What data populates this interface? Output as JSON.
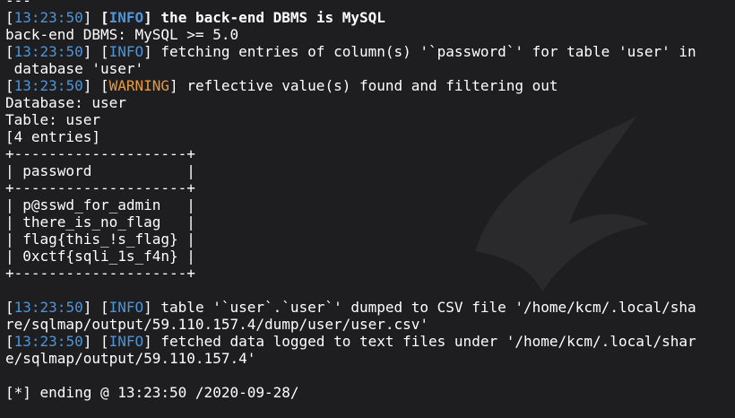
{
  "terminal": {
    "top_line": "---",
    "l1": {
      "timestamp": "13:23:50",
      "level": "INFO",
      "message": "the back-end DBMS is MySQL"
    },
    "l2": "back-end DBMS: MySQL >= 5.0",
    "l3": {
      "timestamp": "13:23:50",
      "level": "INFO",
      "message": "fetching entries of column(s) '`password`' for table 'user' in",
      "continuation": " database 'user'"
    },
    "l4": {
      "timestamp": "13:23:50",
      "level": "WARNING",
      "message": "reflective value(s) found and filtering out"
    },
    "db_line": "Database: user",
    "table_line": "Table: user",
    "count_line": "[4 entries]",
    "table": {
      "border": "+--------------------+",
      "header": "| password           |",
      "rows": [
        "| p@sswd_for_admin   |",
        "| there_is_no_flag   |",
        "| flag{this_!s_flag} |",
        "| 0xctf{sqli_1s_f4n} |"
      ]
    },
    "l5": {
      "timestamp": "13:23:50",
      "level": "INFO",
      "message": "table '`user`.`user`' dumped to CSV file '/home/kcm/.local/sha",
      "continuation": "re/sqlmap/output/59.110.157.4/dump/user/user.csv'"
    },
    "l6": {
      "timestamp": "13:23:50",
      "level": "INFO",
      "message": "fetched data logged to text files under '/home/kcm/.local/shar",
      "continuation": "e/sqlmap/output/59.110.157.4'"
    },
    "ending": "[*] ending @ 13:23:50 /2020-09-28/"
  },
  "colors": {
    "background": "#1e1e21",
    "text": "#ffffff",
    "timestamp": "#4d95d8",
    "info": "#4d95d8",
    "warning": "#e89a3c"
  },
  "icons": {
    "watermark": "kali-dragon-watermark-icon"
  }
}
